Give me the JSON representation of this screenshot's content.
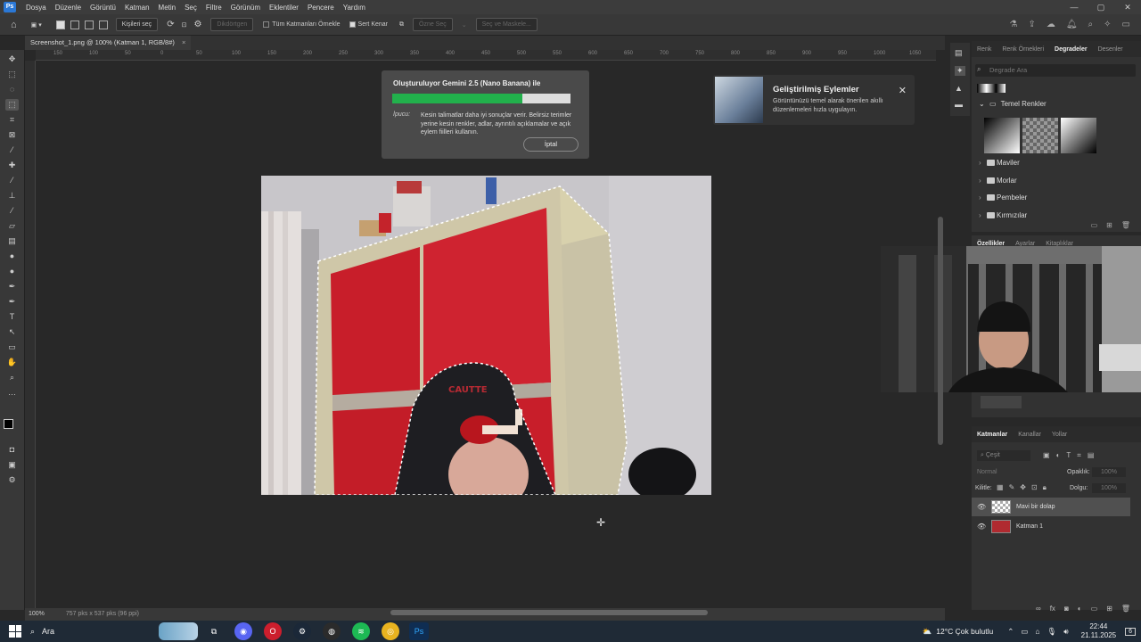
{
  "menu": {
    "items": [
      "Dosya",
      "Düzenle",
      "Görüntü",
      "Katman",
      "Metin",
      "Seç",
      "Filtre",
      "Görünüm",
      "Eklentiler",
      "Pencere",
      "Yardım"
    ]
  },
  "options_bar": {
    "select_subject": "Kişileri seç",
    "refine": "Dikdörtgen",
    "sample_all": "Tüm Katmanları Örnekle",
    "hard_edge": "Sert Kenar",
    "select_subject2": "Özne Seç",
    "select_mask": "Seç ve Maskele..."
  },
  "document_tab": "Screenshot_1.png @ 100% (Katman 1, RGB/8#)",
  "ruler_ticks": [
    "150",
    "100",
    "50",
    "0",
    "50",
    "100",
    "150",
    "200",
    "250",
    "300",
    "350",
    "400",
    "450",
    "500",
    "550",
    "600",
    "650",
    "700",
    "750",
    "800",
    "850",
    "900",
    "950",
    "1000",
    "1050"
  ],
  "progress_dialog": {
    "title": "Oluşturuluyor Gemini 2.5 (Nano Banana) ile",
    "progress_fraction": 0.73,
    "hint_label": "İpucu:",
    "hint": "Kesin talimatlar daha iyi sonuçlar verir. Belirsiz terimler yerine kesin renkler, adlar, ayrıntılı açıklamalar ve açık eylem fiilleri kullanın.",
    "cancel": "İptal"
  },
  "toast": {
    "title": "Geliştirilmiş Eylemler",
    "description": "Görüntünüzü temel alarak önerilen akıllı düzenlemeleri hızla uygulayın."
  },
  "gradients_panel": {
    "tabs": [
      "Renk",
      "Renk Örnekleri",
      "Degradeler",
      "Desenler"
    ],
    "active_tab": "Degradeler",
    "search_placeholder": "Degrade Ara",
    "group": "Temel Renkler",
    "folders": [
      "Maviler",
      "Morlar",
      "Pembeler",
      "Kırmızılar"
    ]
  },
  "properties_panel": {
    "tabs": [
      "Özellikler",
      "Ayarlar",
      "Kitaplıklar"
    ],
    "active_tab": "Özellikler"
  },
  "layers_panel": {
    "tabs": [
      "Katmanlar",
      "Kanallar",
      "Yollar"
    ],
    "active_tab": "Katmanlar",
    "filter_placeholder": "Çeşit",
    "blend_mode": "Normal",
    "opacity_label": "Opaklık:",
    "opacity_value": "100%",
    "lock_label": "Kilitle:",
    "fill_label": "Dolgu:",
    "fill_value": "100%",
    "layers": [
      {
        "name": "Mavi bir dolap",
        "selected": true
      },
      {
        "name": "Katman 1",
        "selected": false
      }
    ]
  },
  "status_bar": {
    "zoom": "100%",
    "doc_size": "757 pks x 537 pks (96 ppi)"
  },
  "taskbar": {
    "search": "Ara",
    "weather": "12°C  Çok bulutlu",
    "time": "22:44",
    "date": "21.11.2025",
    "notifications": "6"
  },
  "colors": {
    "accent": "#22b14c",
    "photo_red": "#c81e2a",
    "taskbar": "#1f2a36"
  }
}
